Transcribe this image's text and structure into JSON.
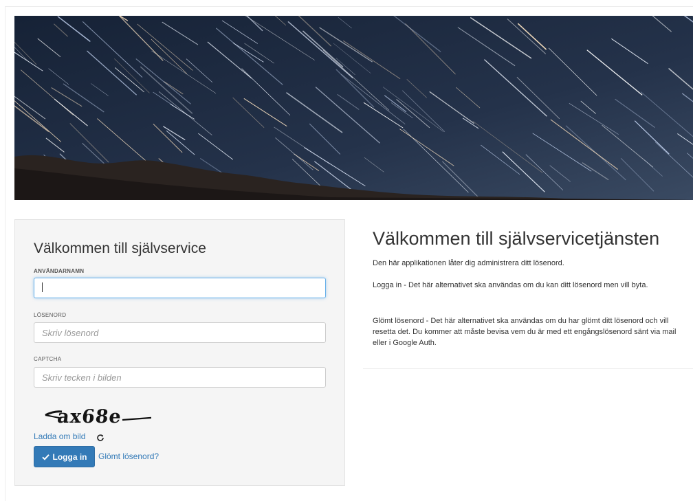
{
  "login": {
    "title": "Välkommen till självservice",
    "username_label": "ANVÄNDARNAMN",
    "username_value": "",
    "password_label": "LÖSENORD",
    "password_placeholder": "Skriv lösenord",
    "captcha_label": "CAPTCHA",
    "captcha_placeholder": "Skriv tecken i bilden",
    "captcha_text": "ax68e",
    "reload_label": "Ladda om bild",
    "login_button_label": "Logga in",
    "forgot_label": "Glömt lösenord?"
  },
  "info": {
    "title": "Välkommen till självservicetjänsten",
    "paragraphs": [
      "Den här applikationen låter dig administrera ditt lösenord.",
      "Logga in - Det här alternativet ska användas om du kan ditt lösenord men vill byta.",
      "Glömt lösenord - Det här alternativet ska användas om du har glömt ditt lösenord och vill resetta det. Du kommer att måste bevisa vem du är med ett engångslösenord sänt via mail eller i Google Auth."
    ]
  },
  "colors": {
    "accent": "#337ab7",
    "panel_bg": "#f5f5f5",
    "focus": "#66afe9"
  },
  "icons": {
    "check": "check-icon",
    "reload": "refresh-icon"
  }
}
